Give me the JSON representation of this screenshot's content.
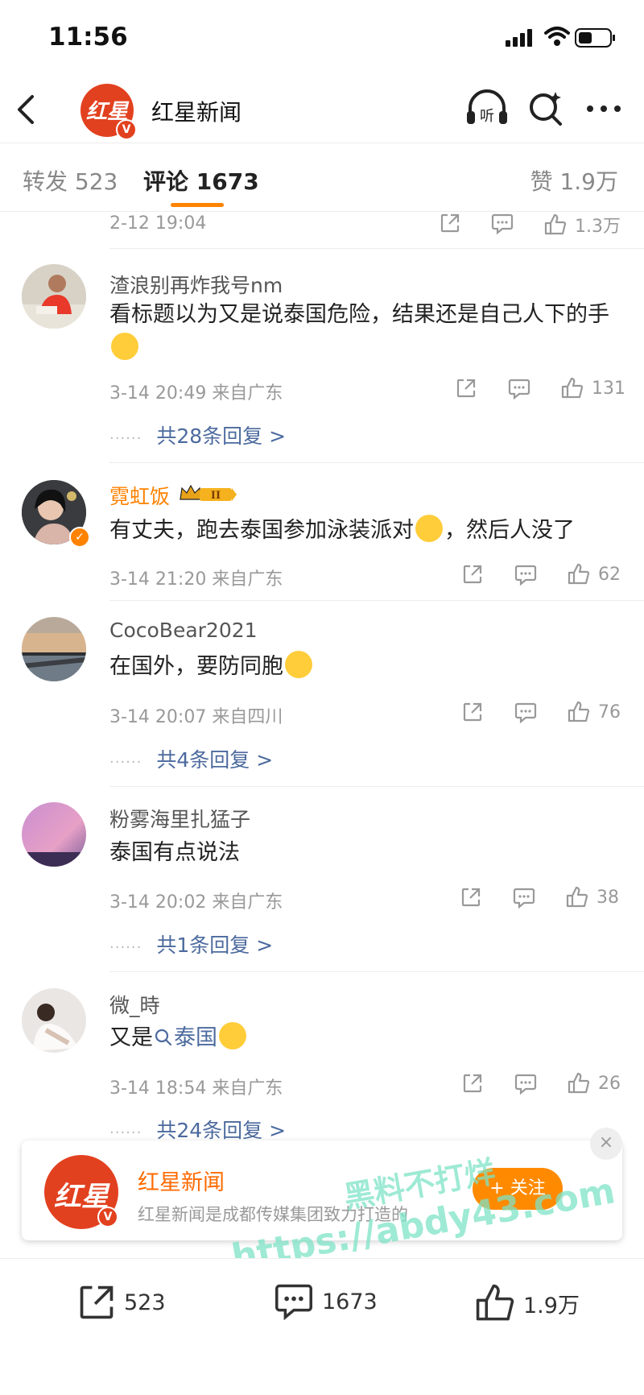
{
  "status_bar": {
    "time": "11:56"
  },
  "header": {
    "account_name": "红星新闻",
    "logo_text": "红星",
    "verified_mark": "V"
  },
  "tabs": {
    "repost": "转发 523",
    "comments": "评论 1673",
    "likes": "赞 1.9万"
  },
  "previous_comment": {
    "time": "2-12 19:04",
    "likes": "1.3万"
  },
  "comments": [
    {
      "user": "渣浪别再炸我号nm",
      "text": "看标题以为又是说泰国危险，结果还是自己人下的手",
      "time": "3-14 20:49",
      "location": "来自广东",
      "likes": "131",
      "replies": "共28条回复 >"
    },
    {
      "user": "霓虹饭",
      "badge": "II",
      "text_before": "有丈夫，跑去泰国参加泳装派对",
      "text_after": "，然后人没了",
      "time": "3-14 21:20",
      "location": "来自广东",
      "likes": "62"
    },
    {
      "user": "CocoBear2021",
      "text": "在国外，要防同胞",
      "time": "3-14 20:07",
      "location": "来自四川",
      "likes": "76",
      "replies": "共4条回复 >"
    },
    {
      "user": "粉雾海里扎猛子",
      "text": "泰国有点说法",
      "time": "3-14 20:02",
      "location": "来自广东",
      "likes": "38",
      "replies": "共1条回复 >"
    },
    {
      "user": "微_時",
      "text_before": "又是",
      "tag": "泰国",
      "time": "3-14 18:54",
      "location": "来自广东",
      "likes": "26",
      "replies": "共24条回复 >"
    }
  ],
  "replies_prefix": "······",
  "ad": {
    "name": "红星新闻",
    "description": "红星新闻是成都传媒集团致力打造的",
    "logo_text": "红星",
    "follow": "+ 关注",
    "close": "×"
  },
  "watermark": {
    "line1": "黑料不打烊",
    "line2": "https://abdy43.com"
  },
  "bottom_bar": {
    "repost": "523",
    "comment": "1673",
    "like": "1.9万"
  },
  "colors": {
    "brand_red": "#e2411f",
    "accent_orange": "#ff8200",
    "link_blue": "#4c6a9e"
  },
  "icons": [
    "back-icon",
    "headphones-icon",
    "search-sparkle-icon",
    "more-icon",
    "share-icon",
    "comment-icon",
    "like-icon"
  ]
}
